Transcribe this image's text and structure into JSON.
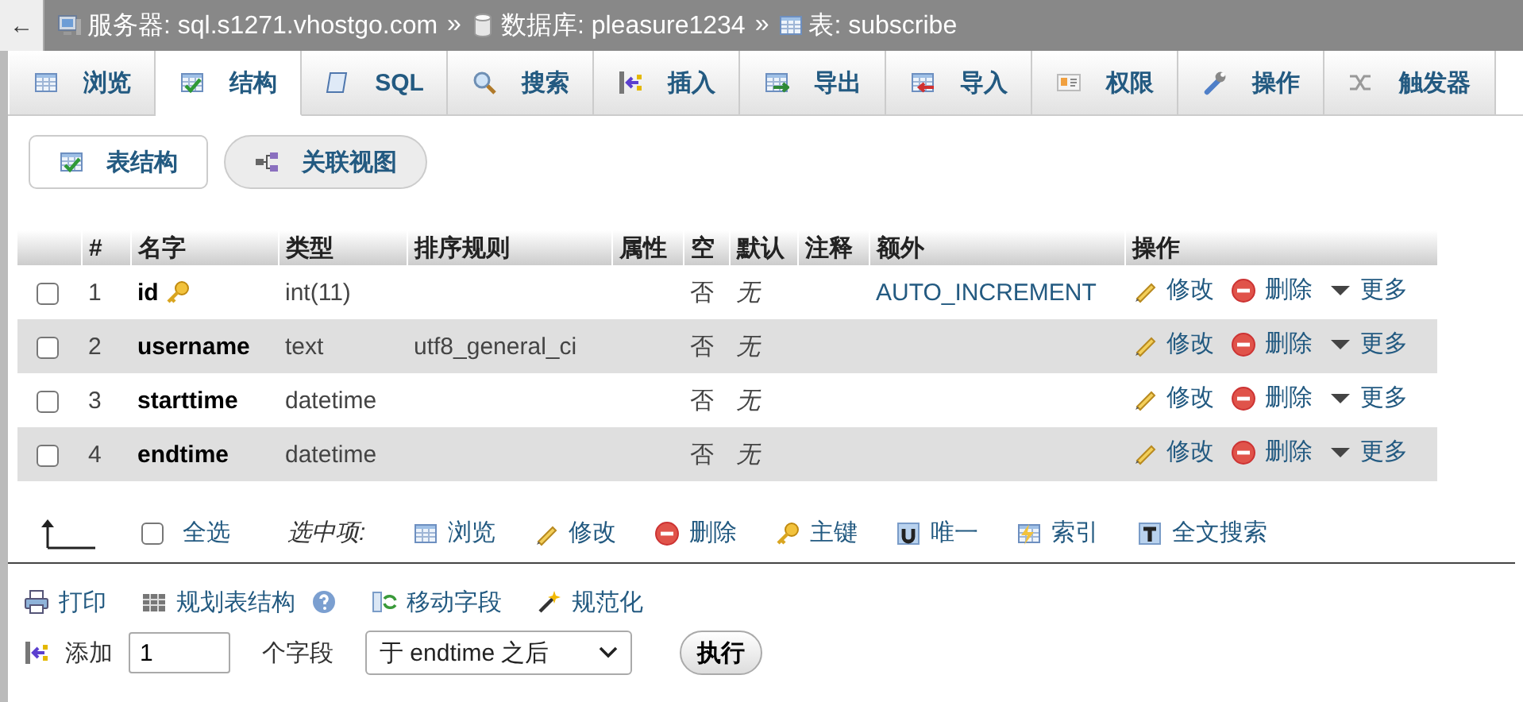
{
  "top_bar": {
    "back_button": "←",
    "separator": "»",
    "breadcrumb": [
      {
        "label": "服务器: sql.s1271.vhostgo.com"
      },
      {
        "label": "数据库: pleasure1234"
      },
      {
        "label": "表: subscribe"
      }
    ]
  },
  "tabs": [
    {
      "label": "浏览",
      "selected": false
    },
    {
      "label": "结构",
      "selected": true
    },
    {
      "label": "SQL",
      "selected": false
    },
    {
      "label": "搜索",
      "selected": false
    },
    {
      "label": "插入",
      "selected": false
    },
    {
      "label": "导出",
      "selected": false
    },
    {
      "label": "导入",
      "selected": false
    },
    {
      "label": "权限",
      "selected": false
    },
    {
      "label": "操作",
      "selected": false
    },
    {
      "label": "触发器",
      "selected": false
    }
  ],
  "sub_tabs": [
    {
      "label": "表结构",
      "selected": true
    },
    {
      "label": "关联视图",
      "selected": false
    }
  ],
  "table": {
    "columns": [
      "#",
      "名字",
      "类型",
      "排序规则",
      "属性",
      "空",
      "默认",
      "注释",
      "额外",
      "操作"
    ],
    "rows": [
      {
        "checked": false,
        "number": "1",
        "name": "id",
        "primary_key": true,
        "type": "int(11)",
        "null": "否",
        "default": "无",
        "extra": "AUTO_INCREMENT",
        "actions": [
          "修改",
          "删除",
          "更多"
        ]
      },
      {
        "checked": false,
        "number": "2",
        "name": "username",
        "primary_key": false,
        "type": "text",
        "collation": "utf8_general_ci",
        "null": "否",
        "default": "无",
        "actions": [
          "修改",
          "删除",
          "更多"
        ]
      },
      {
        "checked": false,
        "number": "3",
        "name": "starttime",
        "primary_key": false,
        "type": "datetime",
        "null": "否",
        "default": "无",
        "actions": [
          "修改",
          "删除",
          "更多"
        ]
      },
      {
        "checked": false,
        "number": "4",
        "name": "endtime",
        "primary_key": false,
        "type": "datetime",
        "null": "否",
        "default": "无",
        "actions": [
          "修改",
          "删除",
          "更多"
        ]
      }
    ]
  },
  "bulk_actions": {
    "check_all": {
      "label": "全选",
      "checked": false
    },
    "with_selected": "选中项:",
    "actions": [
      "浏览",
      "修改",
      "删除",
      "主键",
      "唯一",
      "索引",
      "全文搜索"
    ]
  },
  "tools": [
    {
      "label": "打印",
      "help": false
    },
    {
      "label": "规划表结构",
      "help": true
    },
    {
      "label": "移动字段",
      "help": false
    },
    {
      "label": "规范化",
      "help": false
    }
  ],
  "add_fields": {
    "label": "添加",
    "value": "1",
    "unit": "个字段",
    "position": "于 endtime 之后",
    "button": "执行"
  }
}
